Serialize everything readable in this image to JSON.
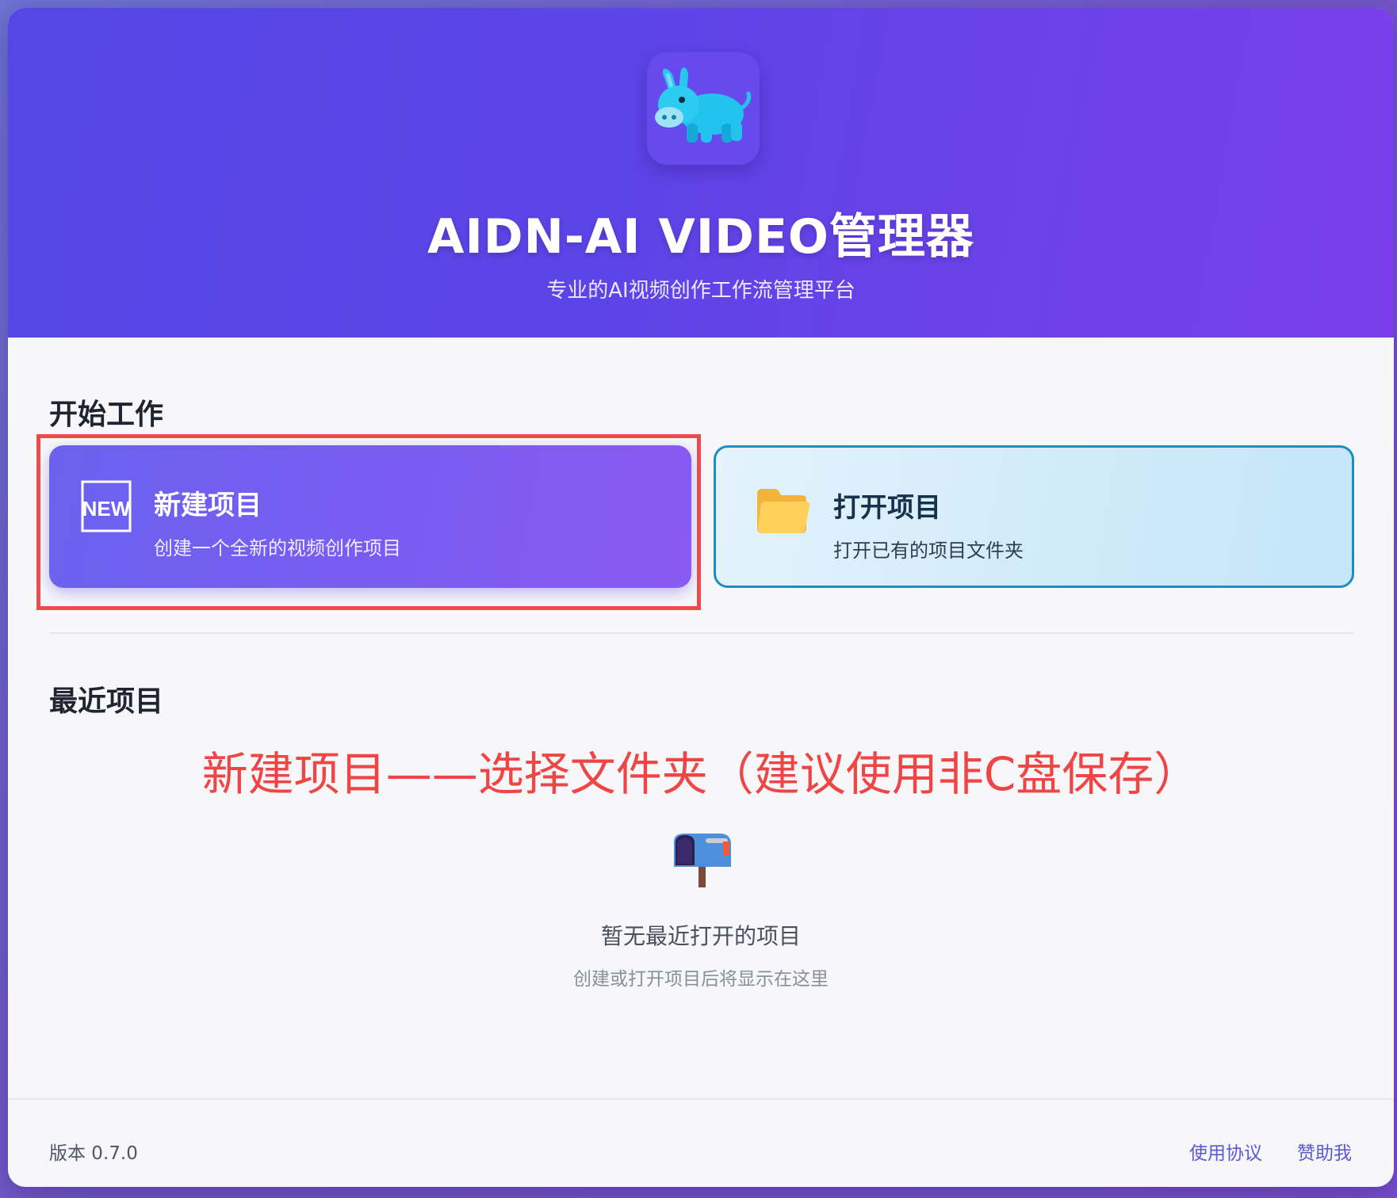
{
  "header": {
    "title": "AIDN-AI VIDEO管理器",
    "subtitle": "专业的AI视频创作工作流管理平台",
    "logo_icon": "donkey-icon"
  },
  "start_section": {
    "title": "开始工作",
    "new_project": {
      "icon": "new-badge-icon",
      "icon_text": "NEW",
      "title": "新建项目",
      "description": "创建一个全新的视频创作项目"
    },
    "open_project": {
      "icon": "folder-icon",
      "title": "打开项目",
      "description": "打开已有的项目文件夹"
    }
  },
  "annotation": {
    "text": "新建项目——选择文件夹（建议使用非C盘保存）",
    "color": "#f04545"
  },
  "recent_section": {
    "title": "最近项目",
    "empty_icon": "mailbox-icon",
    "empty_title": "暂无最近打开的项目",
    "empty_description": "创建或打开项目后将显示在这里"
  },
  "footer": {
    "version": "版本 0.7.0",
    "terms_link": "使用协议",
    "sponsor_link": "赞助我"
  },
  "colors": {
    "header_start": "#5447e6",
    "header_end": "#7a3fea",
    "accent": "#5b58d8",
    "highlight": "#f04b4b"
  }
}
